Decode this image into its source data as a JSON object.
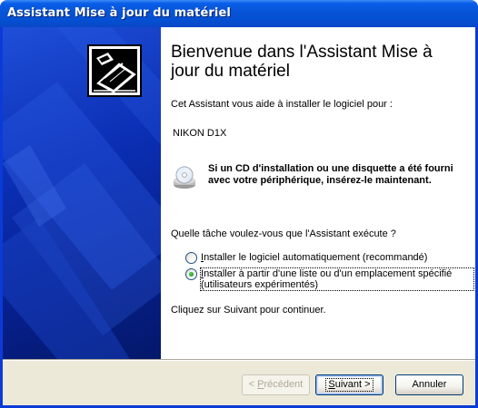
{
  "window": {
    "title": "Assistant Mise à jour du matériel"
  },
  "content": {
    "heading": "Bienvenue dans l'Assistant Mise à jour du matériel",
    "intro": "Cet Assistant vous aide à installer le logiciel pour :",
    "device_name": "NIKON D1X",
    "cd_notice": "Si un CD d'installation ou une disquette a été fourni avec votre périphérique, insérez-le maintenant.",
    "question": "Quelle tâche voulez-vous que l'Assistant exécute ?",
    "options": [
      {
        "label_first": "I",
        "label_rest": "nstaller le logiciel automatiquement (recommandé)",
        "selected": false
      },
      {
        "label_first": "I",
        "label_rest": "nstaller à partir d'une liste ou d'un emplacement spécifié (utilisateurs expérimentés)",
        "selected": true
      }
    ],
    "continue_hint": "Cliquez sur Suivant pour continuer."
  },
  "buttons": {
    "back_prefix": "< ",
    "back_mnemonic": "P",
    "back_rest": "récédent",
    "next_mnemonic": "S",
    "next_rest": "uivant >",
    "cancel": "Annuler"
  },
  "colors": {
    "title_bar": "#0653d6",
    "banner": "#0b2fb4",
    "dialog_face": "#ece9d8",
    "radio_dot": "#21a121"
  },
  "icons": {
    "wizard_banner": "hardware-card-icon",
    "cd": "cd-disk-icon"
  }
}
